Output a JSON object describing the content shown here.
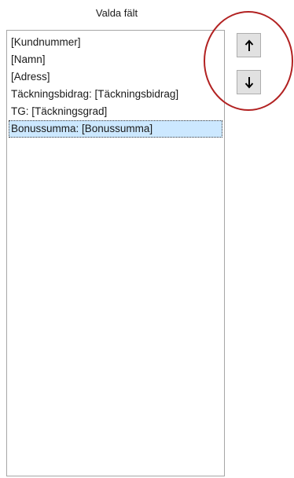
{
  "panel": {
    "title": "Valda fält",
    "items": [
      {
        "label": "[Kundnummer]",
        "selected": false
      },
      {
        "label": "[Namn]",
        "selected": false
      },
      {
        "label": "[Adress]",
        "selected": false
      },
      {
        "label": "Täckningsbidrag: [Täckningsbidrag]",
        "selected": false
      },
      {
        "label": "TG: [Täckningsgrad]",
        "selected": false
      },
      {
        "label": "Bonussumma: [Bonussumma]",
        "selected": true
      }
    ]
  },
  "buttons": {
    "move_up_icon": "arrow-up-icon",
    "move_down_icon": "arrow-down-icon"
  },
  "colors": {
    "selection_background": "#cce8ff",
    "button_background": "#e1e1e1",
    "annotation_ring": "#b22222"
  }
}
